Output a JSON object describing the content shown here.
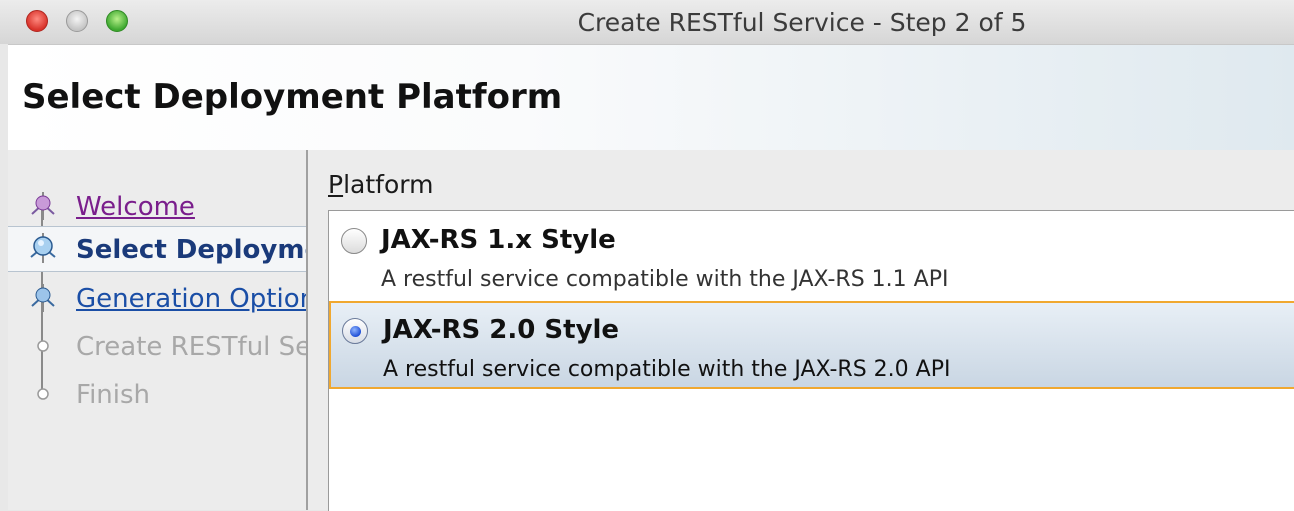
{
  "window": {
    "title": "Create RESTful Service - Step 2 of 5"
  },
  "header": {
    "title": "Select Deployment Platform"
  },
  "steps": [
    {
      "label": "Welcome",
      "state": "done"
    },
    {
      "label": "Select Deployment Platform",
      "state": "current"
    },
    {
      "label": "Generation Options",
      "state": "link"
    },
    {
      "label": "Create RESTful Service",
      "state": "disabled"
    },
    {
      "label": "Finish",
      "state": "disabled"
    }
  ],
  "platform": {
    "label_mnemonic": "P",
    "label_rest": "latform",
    "options": [
      {
        "title": "JAX-RS 1.x Style",
        "description": "A restful service compatible with the JAX-RS 1.1 API",
        "selected": false
      },
      {
        "title": "JAX-RS 2.0 Style",
        "description": "A restful service compatible with the JAX-RS 2.0 API",
        "selected": true
      }
    ]
  },
  "colors": {
    "selection_border": "#f0a830",
    "link_visited": "#7a1e8c",
    "link": "#1a4ea6",
    "current_step": "#1a3a7a"
  }
}
